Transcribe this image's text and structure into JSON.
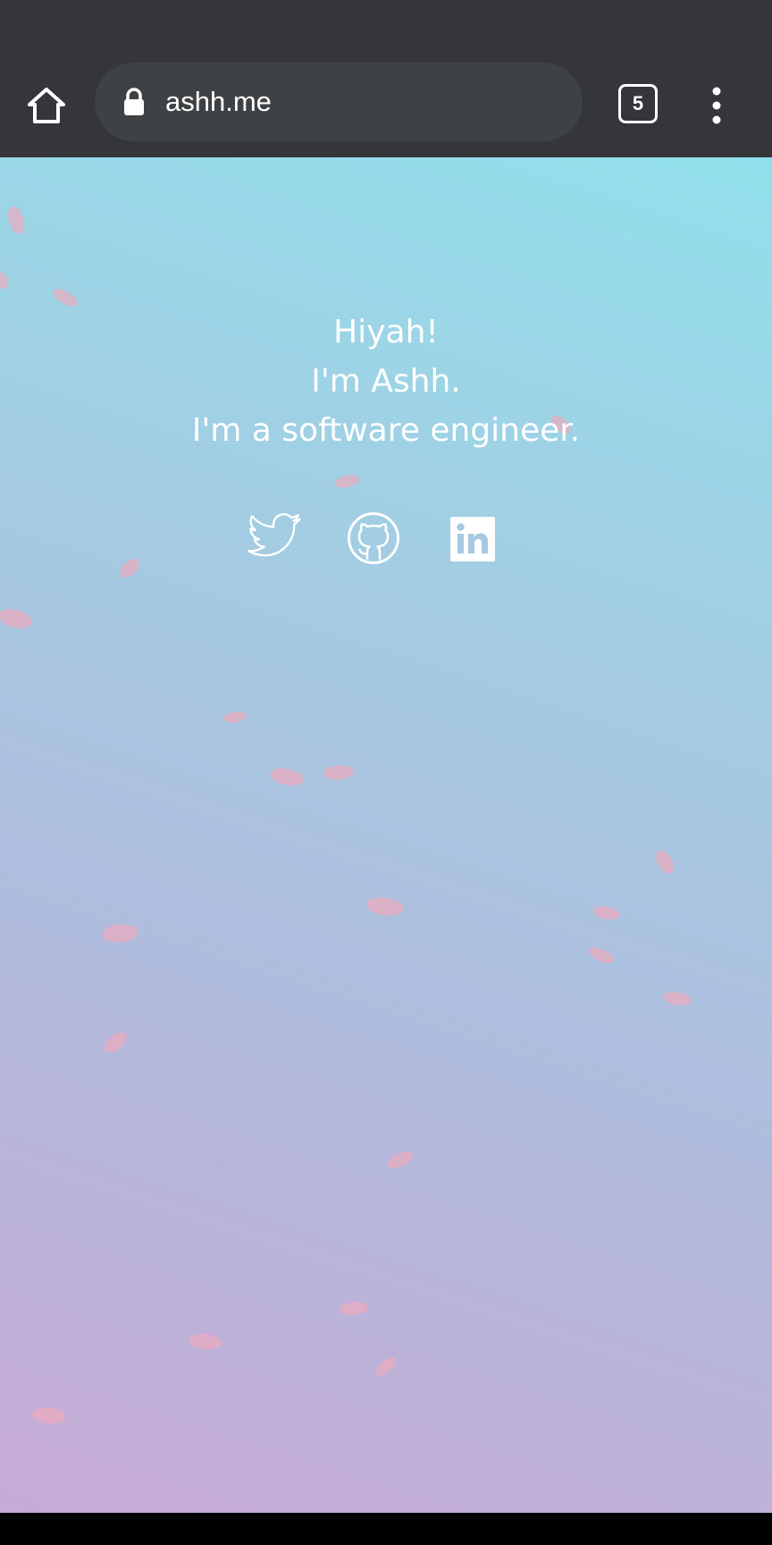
{
  "browser": {
    "url": "ashh.me",
    "tab_count": "5",
    "icons": {
      "home": "home-icon",
      "lock": "lock-icon",
      "tabs": "tab-switcher-icon",
      "menu": "more-vertical-icon"
    }
  },
  "page": {
    "greeting": "Hiyah!",
    "name_line": "I'm Ashh.",
    "role_line": "I'm a software engineer.",
    "social_links": [
      {
        "name": "Twitter",
        "icon": "twitter-icon"
      },
      {
        "name": "GitHub",
        "icon": "github-icon"
      },
      {
        "name": "LinkedIn",
        "icon": "linkedin-icon"
      }
    ]
  },
  "colors": {
    "toolbar": "#35363a",
    "omnibox": "#3f4245",
    "gradient_pink": "#c7aad5",
    "gradient_cyan": "#91e0eb",
    "petal": "#ecaabe",
    "text": "#ffffff"
  }
}
